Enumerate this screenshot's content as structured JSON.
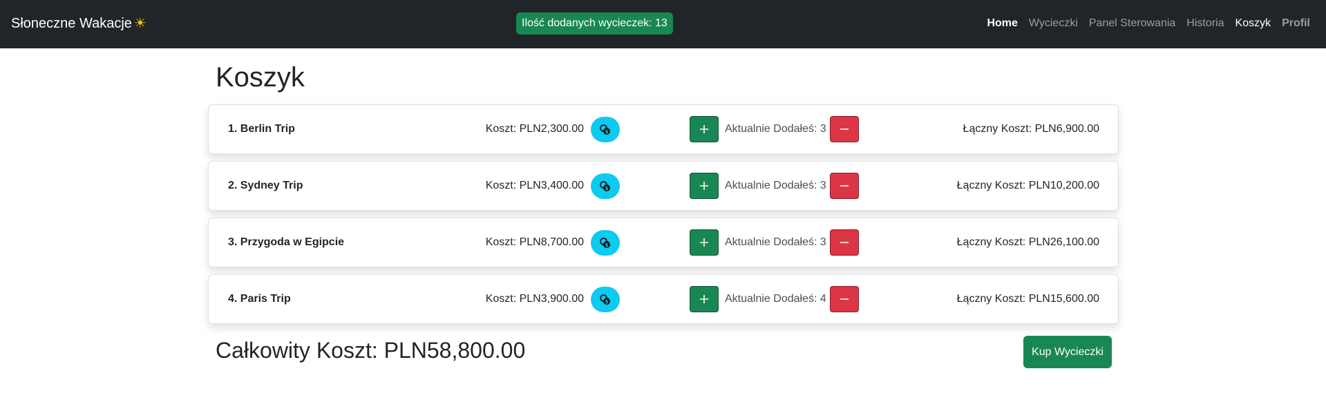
{
  "navbar": {
    "brand": "Słoneczne Wakacje",
    "brand_icon": "sun-icon",
    "badge": "Ilość dodanych wycieczek: 13",
    "links": {
      "home": "Home",
      "trips": "Wycieczki",
      "panel": "Panel Sterowania",
      "history": "Historia",
      "cart": "Koszyk",
      "profile": "Profil"
    }
  },
  "page": {
    "title": "Koszyk",
    "grand_total": "Całkowity Koszt: PLN58,800.00",
    "buy_button": "Kup Wycieczki"
  },
  "colors": {
    "navbar_bg": "#212529",
    "success": "#198754",
    "danger": "#dc3545",
    "info": "#0dcaf0"
  },
  "cart": {
    "items": [
      {
        "name": "1. Berlin Trip",
        "cost": "Koszt: PLN2,300.00",
        "quantity": "Aktualnie Dodałeś: 3",
        "total": "Łączny Koszt: PLN6,900.00"
      },
      {
        "name": "2. Sydney Trip",
        "cost": "Koszt: PLN3,400.00",
        "quantity": "Aktualnie Dodałeś: 3",
        "total": "Łączny Koszt: PLN10,200.00"
      },
      {
        "name": "3. Przygoda w Egipcie",
        "cost": "Koszt: PLN8,700.00",
        "quantity": "Aktualnie Dodałeś: 3",
        "total": "Łączny Koszt: PLN26,100.00"
      },
      {
        "name": "4. Paris Trip",
        "cost": "Koszt: PLN3,900.00",
        "quantity": "Aktualnie Dodałeś: 4",
        "total": "Łączny Koszt: PLN15,600.00"
      }
    ],
    "icons": {
      "coin": "coins-icon",
      "plus": "plus-icon",
      "minus": "minus-icon"
    }
  }
}
